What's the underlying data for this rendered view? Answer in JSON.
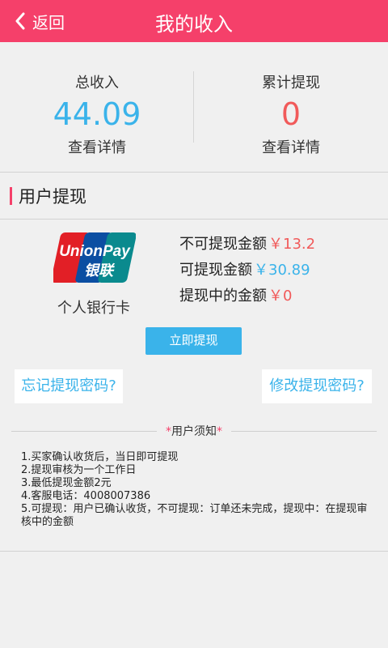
{
  "header": {
    "back_label": "返回",
    "title": "我的收入",
    "bg_color": "#f5406a"
  },
  "stats": {
    "total_income": {
      "label": "总收入",
      "value": "44.09",
      "detail": "查看详情"
    },
    "total_withdrawn": {
      "label": "累计提现",
      "value": "0",
      "detail": "查看详情"
    }
  },
  "withdraw": {
    "section_title": "用户提现",
    "card_label": "个人银行卡",
    "card_logo": {
      "brand_text": "UnionPay",
      "cn_text": "银联",
      "icon": "unionpay-logo"
    },
    "amounts": [
      {
        "label": "不可提现金额",
        "value": "￥13.2",
        "color": "#f15a5a"
      },
      {
        "label": "可提现金额",
        "value": "￥30.89",
        "color": "#3ab3ea"
      },
      {
        "label": "提现中的金额",
        "value": "￥0",
        "color": "#f15a5a"
      }
    ],
    "button_label": "立即提现",
    "forgot_password": "忘记提现密码?",
    "change_password": "修改提现密码?"
  },
  "notice": {
    "title": "用户须知",
    "star": "*",
    "items": [
      "1.买家确认收货后，当日即可提现",
      "2.提现审核为一个工作日",
      "3.最低提现金额2元",
      "4.客服电话：4008007386",
      "5.可提现：用户已确认收货，不可提现：订单还未完成，提现中：在提现审核中的金额"
    ]
  }
}
